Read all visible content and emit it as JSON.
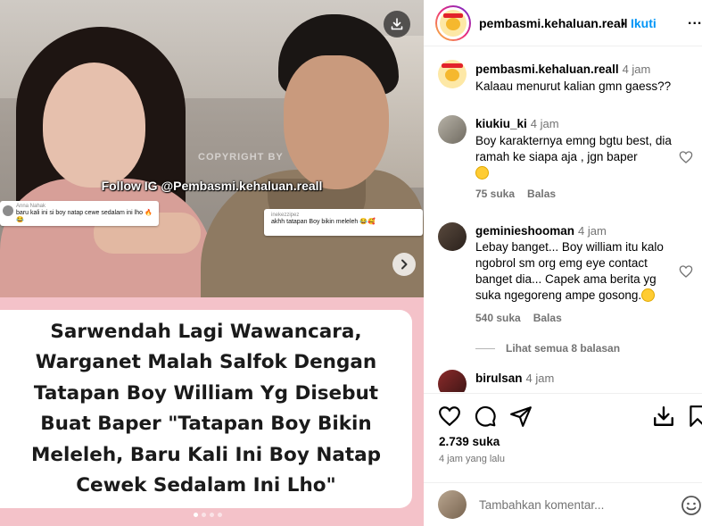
{
  "post": {
    "watermark": "COPYRIGHT BY",
    "overlay_text": "Follow IG @Pembasmi.kehaluan.reall",
    "embedded_comments": [
      {
        "user": "Anna Nahak",
        "text": "baru kali ini si boy natap cewe sedalam ini lho 🔥😂"
      },
      {
        "user": "inekezzipez",
        "text": "akhh tatapan Boy bikin meleleh 😂🥰"
      }
    ],
    "caption": "Sarwendah Lagi Wawancara, Warganet Malah Salfok Dengan Tatapan Boy William Yg Disebut Buat Baper \"Tatapan Boy Bikin Meleleh, Baru Kali Ini Boy Natap Cewek Sedalam Ini Lho\"",
    "carousel": {
      "count": 4,
      "active": 0
    }
  },
  "header": {
    "username": "pembasmi.kehaluan.reall",
    "separator": "•",
    "follow_label": "Ikuti",
    "more_label": "..."
  },
  "comments": [
    {
      "user": "pembasmi.kehaluan.reall",
      "time": "4 jam",
      "text": "Kalaau menurut kalian gmn gaess??"
    },
    {
      "user": "kiukiu_ki",
      "time": "4 jam",
      "text": "Boy karakternya emng bgtu best, dia ramah ke siapa aja , jgn baper",
      "likes": "75 suka",
      "reply": "Balas"
    },
    {
      "user": "geminieshooman",
      "time": "4 jam",
      "text": "Lebay banget... Boy william itu kalo ngobrol sm org emg eye contact banget dia... Capek ama berita yg suka ngegoreng ampe gosong.",
      "likes": "540 suka",
      "reply": "Balas"
    },
    {
      "user": "birulsan",
      "time": "4 jam"
    }
  ],
  "view_replies": "Lihat semua 8 balasan",
  "stats": {
    "likes": "2.739 suka",
    "posted": "4 jam yang lalu"
  },
  "add_comment": {
    "placeholder": "Tambahkan komentar..."
  },
  "icons": [
    "download-icon",
    "chevron-right-icon",
    "heart-icon",
    "comment-icon",
    "share-icon",
    "save-icon",
    "bookmark-icon",
    "emoji-icon"
  ],
  "colors": {
    "accent": "#0095f6",
    "caption_bg": "#f4c2c9",
    "muted": "#737373"
  }
}
